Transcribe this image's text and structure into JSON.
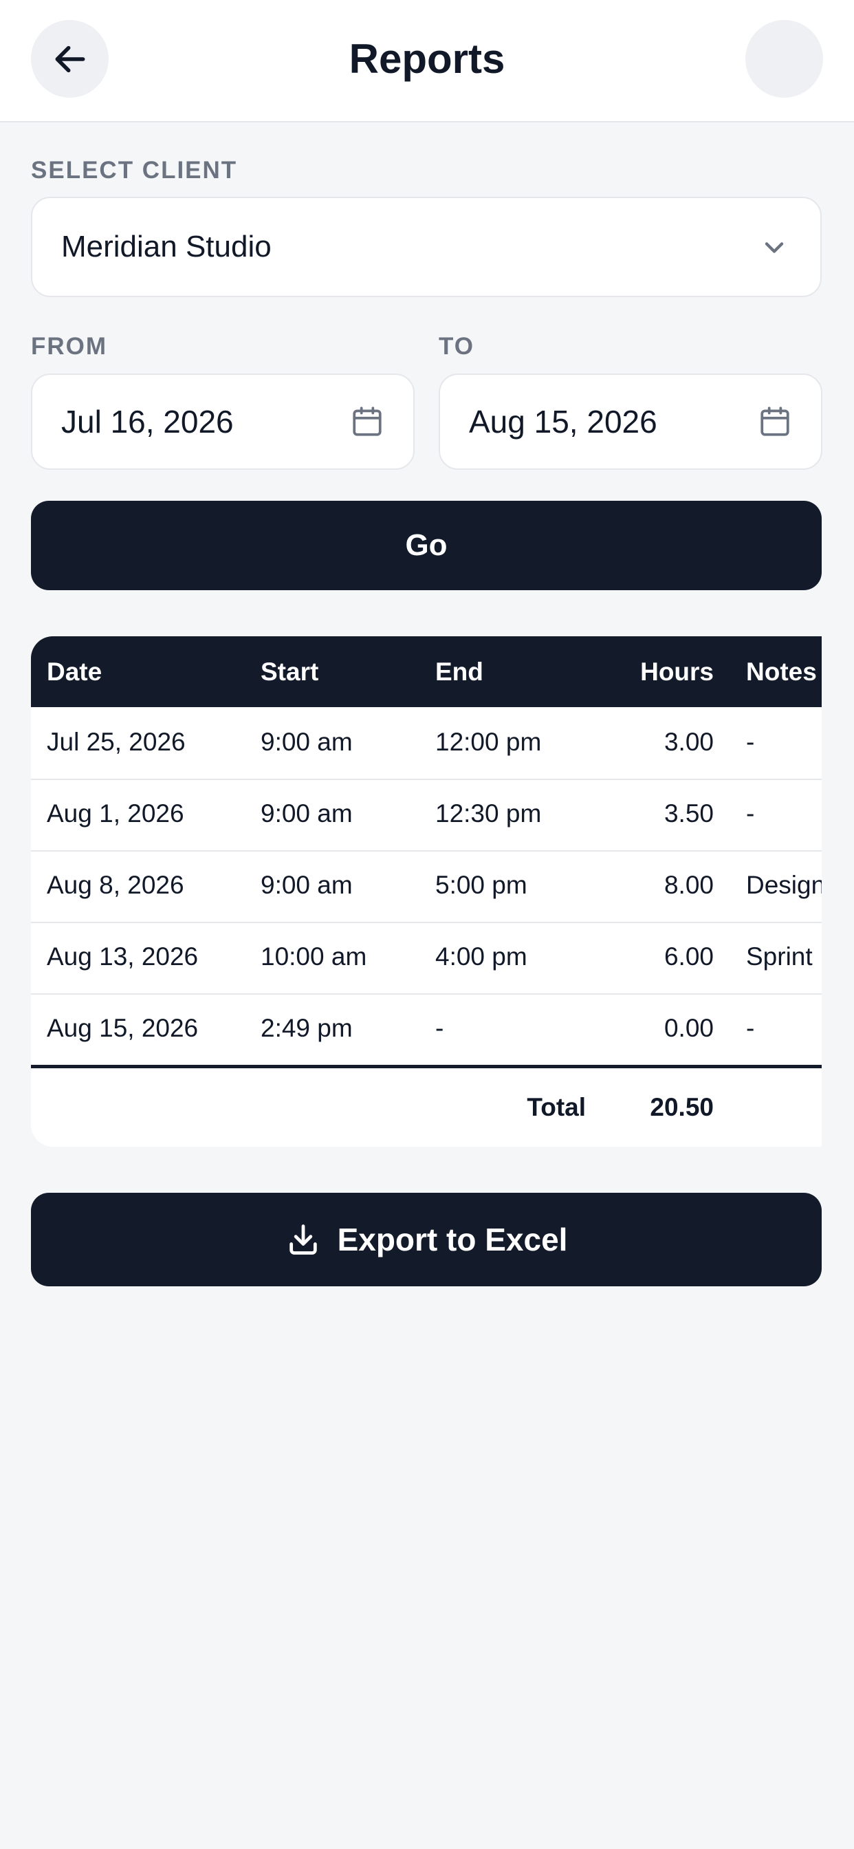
{
  "header": {
    "title": "Reports",
    "back_icon": "arrow-left-icon"
  },
  "client": {
    "label": "SELECT CLIENT",
    "value": "Meridian Studio"
  },
  "range": {
    "from_label": "FROM",
    "from_value": "Jul 16, 2026",
    "to_label": "TO",
    "to_value": "Aug 15, 2026"
  },
  "go_label": "Go",
  "table": {
    "columns": [
      "Date",
      "Start",
      "End",
      "Hours",
      "Notes"
    ],
    "rows": [
      {
        "date": "Jul 25, 2026",
        "start": "9:00 am",
        "end": "12:00 pm",
        "hours": "3.00",
        "notes": "-"
      },
      {
        "date": "Aug 1, 2026",
        "start": "9:00 am",
        "end": "12:30 pm",
        "hours": "3.50",
        "notes": "-"
      },
      {
        "date": "Aug 8, 2026",
        "start": "9:00 am",
        "end": "5:00 pm",
        "hours": "8.00",
        "notes": "Design"
      },
      {
        "date": "Aug 13, 2026",
        "start": "10:00 am",
        "end": "4:00 pm",
        "hours": "6.00",
        "notes": "Sprint"
      },
      {
        "date": "Aug 15, 2026",
        "start": "2:49 pm",
        "end": "-",
        "hours": "0.00",
        "notes": "-"
      }
    ],
    "total_label": "Total",
    "total_value": "20.50"
  },
  "export_label": "Export to Excel",
  "colors": {
    "primary": "#131a2a",
    "background": "#f5f6f8",
    "muted_text": "#6b7280"
  }
}
